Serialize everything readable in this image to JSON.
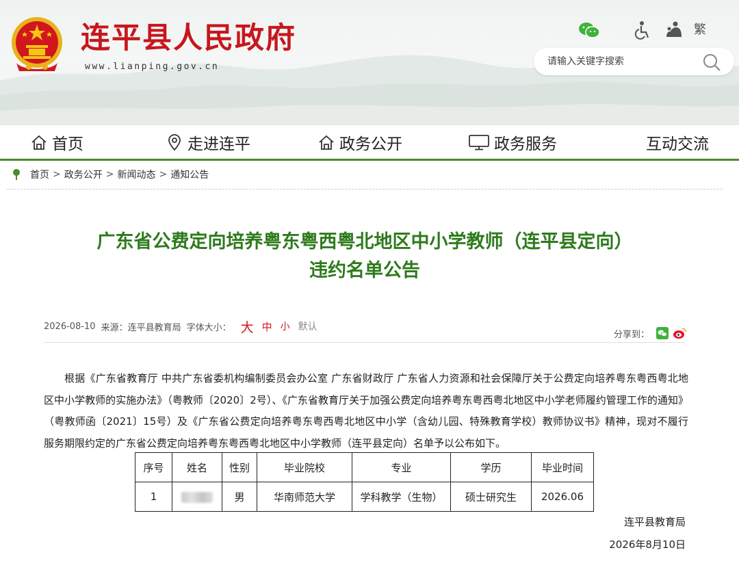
{
  "header": {
    "site_title": "连平县人民政府",
    "site_url": "www.lianping.gov.cn",
    "traditional_link": "繁",
    "search": {
      "placeholder": "请输入关键字搜索",
      "value": ""
    },
    "icons": [
      "wechat-icon",
      "accessibility-icon",
      "elder-care-icon",
      "search-icon"
    ],
    "title_color": "#c8161d"
  },
  "nav": {
    "items": [
      {
        "label": "首页",
        "icon": "home-icon"
      },
      {
        "label": "走进连平",
        "icon": "location-icon"
      },
      {
        "label": "政务公开",
        "icon": "home-icon"
      },
      {
        "label": "政务服务",
        "icon": "monitor-icon"
      },
      {
        "label": "互动交流",
        "icon": ""
      }
    ],
    "accent": "#4a8c2a"
  },
  "breadcrumb": {
    "items": [
      "首页",
      "政务公开",
      "新闻动态",
      "通知公告"
    ],
    "separator": ">"
  },
  "article": {
    "title_line1": "广东省公费定向培养粤东粤西粤北地区中小学教师（连平县定向）",
    "title_line2": "违约名单公告",
    "title_color": "#2e7a1c",
    "date": "2026-08-10",
    "source_label": "来源：",
    "source": "连平县教育局",
    "font_size_label": "字体大小：",
    "font_size_options": {
      "large": "大",
      "medium": "中",
      "small": "小",
      "default": "默认"
    },
    "share_label": "分享到：",
    "share_icons": [
      "wechat-share-icon",
      "weibo-share-icon"
    ],
    "body": "根据《广东省教育厅 中共广东省委机构编制委员会办公室 广东省财政厅 广东省人力资源和社会保障厅关于公费定向培养粤东粤西粤北地区中小学教师的实施办法》（粤教师〔2020〕2号）、《广东省教育厅关于加强公费定向培养粤东粤西粤北地区中小学老师履约管理工作的通知》（粤教师函〔2021〕15号）及《广东省公费定向培养粤东粤西粤北地区中小学（含幼儿园、特殊教育学校）教师协议书》精神，现对不履行服务期限约定的广东省公费定向培养粤东粤西粤北地区中小学教师（连平县定向）名单予以公布如下。",
    "table": {
      "headers": [
        "序号",
        "姓名",
        "性别",
        "毕业院校",
        "专业",
        "学历",
        "毕业时间"
      ],
      "rows": [
        {
          "no": "1",
          "name_redacted": true,
          "gender": "男",
          "school": "华南师范大学",
          "major": "学科教学（生物）",
          "degree": "硕士研究生",
          "grad_time": "2026.06"
        }
      ]
    },
    "signature_org": "连平县教育局",
    "signature_date": "2026年8月10日"
  }
}
